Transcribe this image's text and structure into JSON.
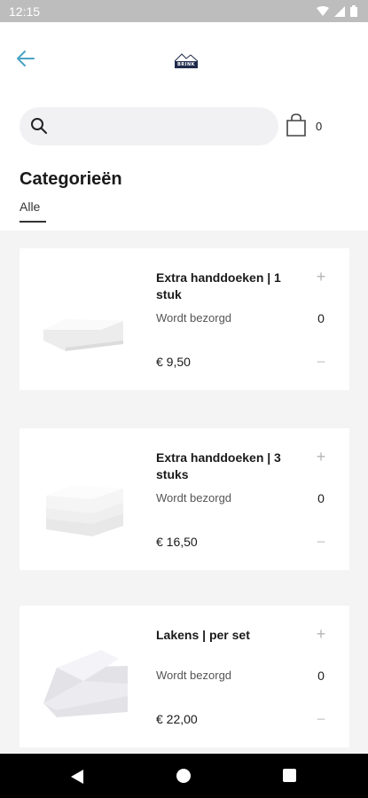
{
  "status_bar": {
    "time": "12:15"
  },
  "header": {
    "logo_text": "BRINK",
    "search": {
      "placeholder": "",
      "value": ""
    },
    "cart_count": "0"
  },
  "categories": {
    "title": "Categorieën",
    "tabs": [
      {
        "label": "Alle",
        "selected": true
      }
    ]
  },
  "products": [
    {
      "title": "Extra handdoeken | 1 stuk",
      "subtitle": "Wordt bezorgd",
      "price": "€ 9,50",
      "quantity": "0"
    },
    {
      "title": "Extra handdoeken | 3 stuks",
      "subtitle": "Wordt bezorgd",
      "price": "€ 16,50",
      "quantity": "0"
    },
    {
      "title": "Lakens | per set",
      "subtitle": "Wordt bezorgd",
      "price": "€ 22,00",
      "quantity": "0"
    }
  ],
  "buttons": {
    "plus": "+",
    "minus": "−"
  },
  "colors": {
    "accent": "#4aa3c4",
    "logo_badge": "#1f2a4a",
    "background": "#f4f4f5"
  }
}
